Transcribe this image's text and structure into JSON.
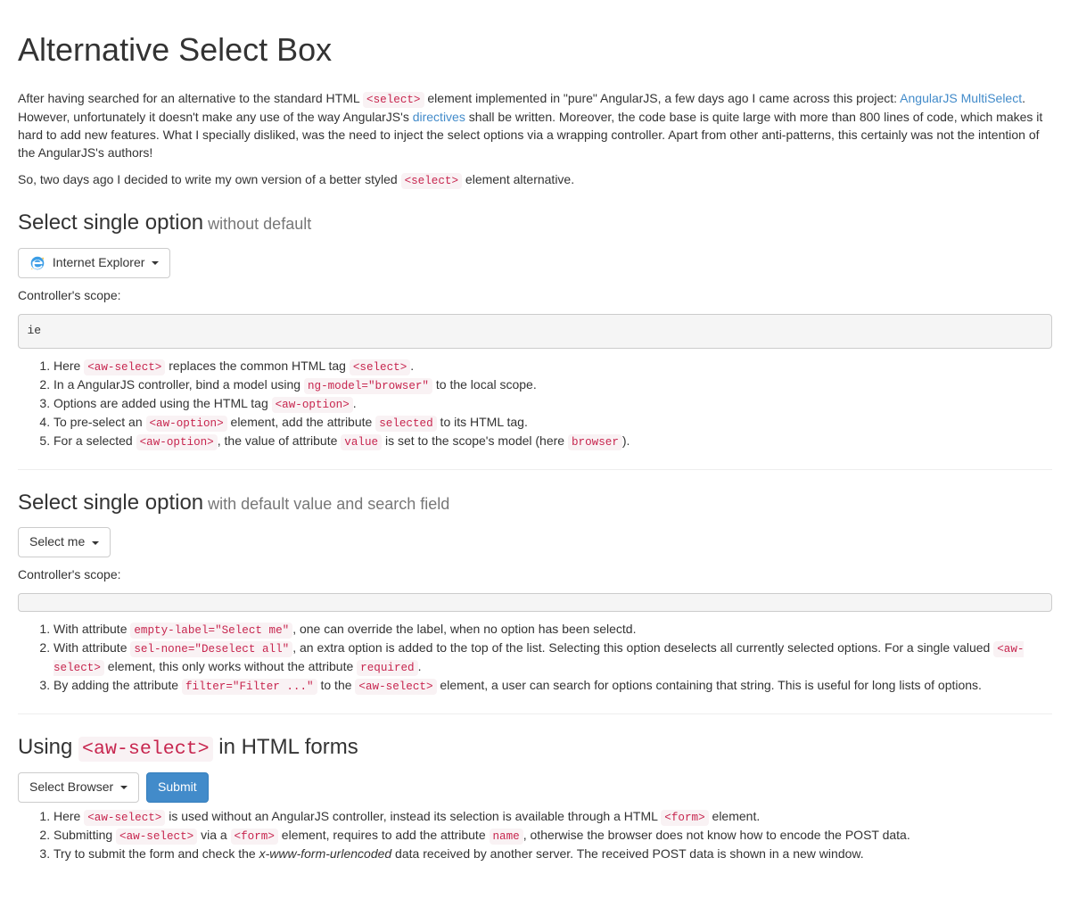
{
  "page": {
    "title": "Alternative Select Box"
  },
  "intro": {
    "p1_a": "After having searched for an alternative to the standard HTML ",
    "p1_code1": "<select>",
    "p1_b": " element implemented in \"pure\" AngularJS, a few days ago I came across this project: ",
    "p1_link": "AngularJS MultiSelect",
    "p1_c": ". However, unfortunately it doesn't make any use of the way AngularJS's ",
    "p1_link2": "directives",
    "p1_d": " shall be written. Moreover, the code base is quite large with more than 800 lines of code, which makes it hard to add new features. What I specially disliked, was the need to inject the select options via a wrapping controller. Apart from other anti-patterns, this certainly was not the intention of the AngularJS's authors!",
    "p2_a": "So, two days ago I decided to write my own version of a better styled ",
    "p2_code1": "<select>",
    "p2_b": " element alternative."
  },
  "section1": {
    "heading": "Select single option",
    "heading_sub": " without default",
    "dropdown_label": "Internet Explorer",
    "scope_label": "Controller's scope:",
    "scope_value": "ie",
    "items": {
      "i1_a": "Here ",
      "i1_code1": "<aw-select>",
      "i1_b": " replaces the common HTML tag ",
      "i1_code2": "<select>",
      "i1_c": ".",
      "i2_a": "In a AngularJS controller, bind a model using ",
      "i2_code1": "ng-model=\"browser\"",
      "i2_b": " to the local scope.",
      "i3_a": "Options are added using the HTML tag ",
      "i3_code1": "<aw-option>",
      "i3_b": ".",
      "i4_a": "To pre-select an ",
      "i4_code1": "<aw-option>",
      "i4_b": " element, add the attribute ",
      "i4_code2": "selected",
      "i4_c": " to its HTML tag.",
      "i5_a": "For a selected ",
      "i5_code1": "<aw-option>",
      "i5_b": ", the value of attribute ",
      "i5_code2": "value",
      "i5_c": " is set to the scope's model (here ",
      "i5_code3": "browser",
      "i5_d": ")."
    }
  },
  "section2": {
    "heading": "Select single option",
    "heading_sub": " with default value and search field",
    "dropdown_label": "Select me",
    "scope_label": "Controller's scope:",
    "scope_value": "",
    "items": {
      "i1_a": "With attribute ",
      "i1_code1": "empty-label=\"Select me\"",
      "i1_b": ", one can override the label, when no option has been selectd.",
      "i2_a": "With attribute ",
      "i2_code1": "sel-none=\"Deselect all\"",
      "i2_b": ", an extra option is added to the top of the list. Selecting this option deselects all currently selected options. For a single valued ",
      "i2_code2": "<aw-select>",
      "i2_c": " element, this only works without the attribute ",
      "i2_code3": "required",
      "i2_d": ".",
      "i3_a": "By adding the attribute ",
      "i3_code1": "filter=\"Filter ...\"",
      "i3_b": " to the ",
      "i3_code2": "<aw-select>",
      "i3_c": " element, a user can search for options containing that string. This is useful for long lists of options."
    }
  },
  "section3": {
    "heading_a": "Using ",
    "heading_code": "<aw-select>",
    "heading_b": " in HTML forms",
    "dropdown_label": "Select Browser",
    "submit_label": "Submit",
    "items": {
      "i1_a": "Here ",
      "i1_code1": "<aw-select>",
      "i1_b": " is used without an AngularJS controller, instead its selection is available through a HTML ",
      "i1_code2": "<form>",
      "i1_c": " element.",
      "i2_a": "Submitting ",
      "i2_code1": "<aw-select>",
      "i2_b": " via a ",
      "i2_code2": "<form>",
      "i2_c": " element, requires to add the attribute ",
      "i2_code3": "name",
      "i2_d": ", otherwise the browser does not know how to encode the POST data.",
      "i3_a": "Try to submit the form and check the ",
      "i3_em": "x-www-form-urlencoded",
      "i3_b": " data received by another server. The received POST data is shown in a new window."
    }
  }
}
